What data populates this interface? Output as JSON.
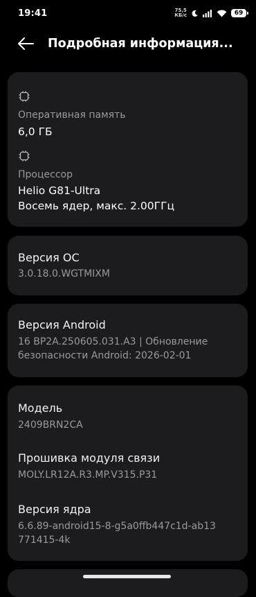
{
  "status": {
    "time": "19:41",
    "net_speed_value": "75,5",
    "net_speed_unit": "КБ/с",
    "battery": "69",
    "icons": [
      "moon-icon",
      "signal-icon",
      "wifi-icon",
      "battery-icon"
    ]
  },
  "header": {
    "title": "Подробная информация..."
  },
  "hardware": {
    "ram_label": "Оперативная память",
    "ram_value": "6,0 ГБ",
    "cpu_label": "Процессор",
    "cpu_name": "Helio G81-Ultra",
    "cpu_desc": "Восемь ядер, макс. 2.00ГГц"
  },
  "os": {
    "label": "Версия ОС",
    "value": "3.0.18.0.WGTMIXM"
  },
  "android": {
    "label": "Версия Android",
    "value_line1": "16 BP2A.250605.031.A3 | Обновление",
    "value_line2": "безопасности Android: 2026-02-01"
  },
  "device": {
    "model_label": "Модель",
    "model_value": "2409BRN2CA",
    "baseband_label": "Прошивка модуля связи",
    "baseband_value": "MOLY.LR12A.R3.MP.V315.P31",
    "kernel_label": "Версия ядра",
    "kernel_line1": "6.6.89-android15-8-g5a0ffb447c1d-ab13",
    "kernel_line2": "771415-4k"
  }
}
